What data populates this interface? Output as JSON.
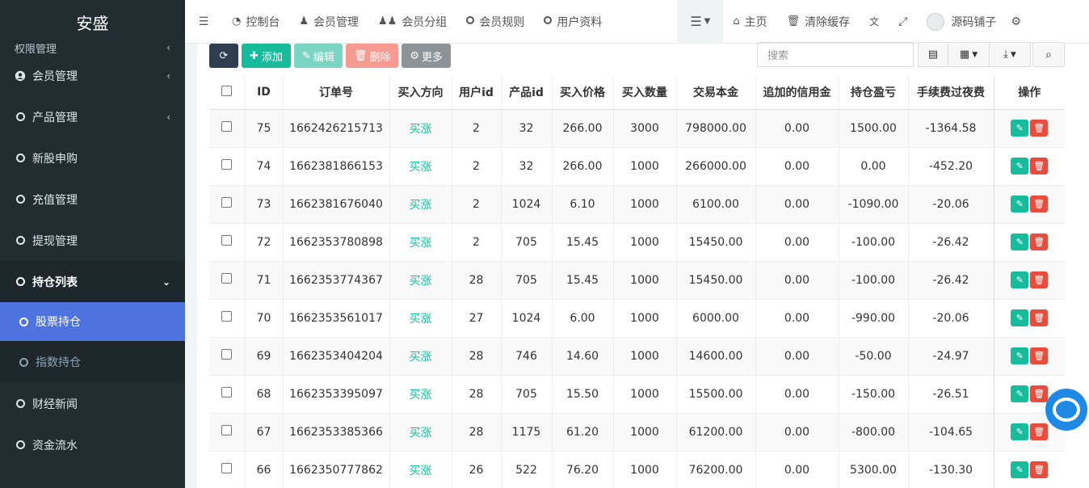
{
  "sidebar": {
    "brand": "安盛",
    "partial_item": "权限管理",
    "items": [
      {
        "label": "会员管理"
      },
      {
        "label": "产品管理"
      },
      {
        "label": "新股申购"
      },
      {
        "label": "充值管理"
      },
      {
        "label": "提现管理"
      },
      {
        "label": "持仓列表"
      },
      {
        "label": "股票持仓"
      },
      {
        "label": "指数持仓"
      },
      {
        "label": "财经新闻"
      },
      {
        "label": "资金流水"
      }
    ]
  },
  "topnav": {
    "dashboard": "控制台",
    "members": "会员管理",
    "groups": "会员分组",
    "rules": "会员规则",
    "profile": "用户资料",
    "home": "主页",
    "clear_cache": "清除缓存",
    "user": "源码铺子"
  },
  "toolbar": {
    "add": "添加",
    "edit": "编辑",
    "delete": "删除",
    "more": "更多",
    "search_placeholder": "搜索"
  },
  "table": {
    "headers": [
      "ID",
      "订单号",
      "买入方向",
      "用户id",
      "产品id",
      "买入价格",
      "买入数量",
      "交易本金",
      "追加的信用金",
      "持仓盈亏",
      "手续费过夜费",
      "操作"
    ],
    "rows": [
      {
        "id": "75",
        "order": "1662426215713",
        "dir": "买涨",
        "uid": "2",
        "pid": "32",
        "price": "266.00",
        "qty": "3000",
        "principal": "798000.00",
        "credit": "0.00",
        "pnl": "1500.00",
        "fee": "-1364.58"
      },
      {
        "id": "74",
        "order": "1662381866153",
        "dir": "买涨",
        "uid": "2",
        "pid": "32",
        "price": "266.00",
        "qty": "1000",
        "principal": "266000.00",
        "credit": "0.00",
        "pnl": "0.00",
        "fee": "-452.20"
      },
      {
        "id": "73",
        "order": "1662381676040",
        "dir": "买涨",
        "uid": "2",
        "pid": "1024",
        "price": "6.10",
        "qty": "1000",
        "principal": "6100.00",
        "credit": "0.00",
        "pnl": "-1090.00",
        "fee": "-20.06"
      },
      {
        "id": "72",
        "order": "1662353780898",
        "dir": "买涨",
        "uid": "2",
        "pid": "705",
        "price": "15.45",
        "qty": "1000",
        "principal": "15450.00",
        "credit": "0.00",
        "pnl": "-100.00",
        "fee": "-26.42"
      },
      {
        "id": "71",
        "order": "1662353774367",
        "dir": "买涨",
        "uid": "28",
        "pid": "705",
        "price": "15.45",
        "qty": "1000",
        "principal": "15450.00",
        "credit": "0.00",
        "pnl": "-100.00",
        "fee": "-26.42"
      },
      {
        "id": "70",
        "order": "1662353561017",
        "dir": "买涨",
        "uid": "27",
        "pid": "1024",
        "price": "6.00",
        "qty": "1000",
        "principal": "6000.00",
        "credit": "0.00",
        "pnl": "-990.00",
        "fee": "-20.06"
      },
      {
        "id": "69",
        "order": "1662353404204",
        "dir": "买涨",
        "uid": "28",
        "pid": "746",
        "price": "14.60",
        "qty": "1000",
        "principal": "14600.00",
        "credit": "0.00",
        "pnl": "-50.00",
        "fee": "-24.97"
      },
      {
        "id": "68",
        "order": "1662353395097",
        "dir": "买涨",
        "uid": "28",
        "pid": "705",
        "price": "15.50",
        "qty": "1000",
        "principal": "15500.00",
        "credit": "0.00",
        "pnl": "-150.00",
        "fee": "-26.51"
      },
      {
        "id": "67",
        "order": "1662353385366",
        "dir": "买涨",
        "uid": "28",
        "pid": "1175",
        "price": "61.20",
        "qty": "1000",
        "principal": "61200.00",
        "credit": "0.00",
        "pnl": "-800.00",
        "fee": "-104.65"
      },
      {
        "id": "66",
        "order": "1662350777862",
        "dir": "买涨",
        "uid": "26",
        "pid": "522",
        "price": "76.20",
        "qty": "1000",
        "principal": "76200.00",
        "credit": "0.00",
        "pnl": "5300.00",
        "fee": "-130.30"
      }
    ]
  },
  "colors": {
    "sidebar_bg": "#222d32",
    "active": "#4e73df",
    "success": "#18bc9c",
    "danger": "#e74c3c"
  }
}
